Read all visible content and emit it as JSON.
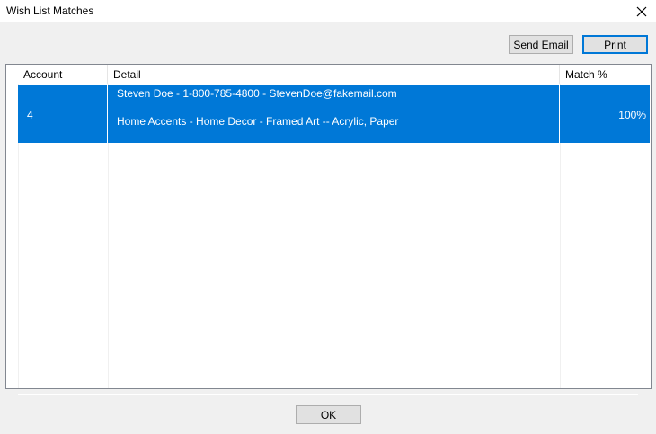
{
  "window": {
    "title": "Wish List Matches",
    "close_icon": "close-icon"
  },
  "toolbar": {
    "send_email_label": "Send Email",
    "print_label": "Print"
  },
  "list": {
    "columns": [
      "Account",
      "Detail",
      "Match %"
    ],
    "rows": [
      {
        "account": "4",
        "detail_line1": "Steven Doe - 1-800-785-4800 - StevenDoe@fakemail.com",
        "detail_line2": "Home Accents - Home Decor - Framed Art -- Acrylic, Paper",
        "match": "100%",
        "selected": true
      }
    ]
  },
  "footer": {
    "ok_label": "OK"
  },
  "colors": {
    "selection": "#0078d7",
    "default_button_border": "#0078d7",
    "dialog_bg": "#f0f0f0"
  }
}
